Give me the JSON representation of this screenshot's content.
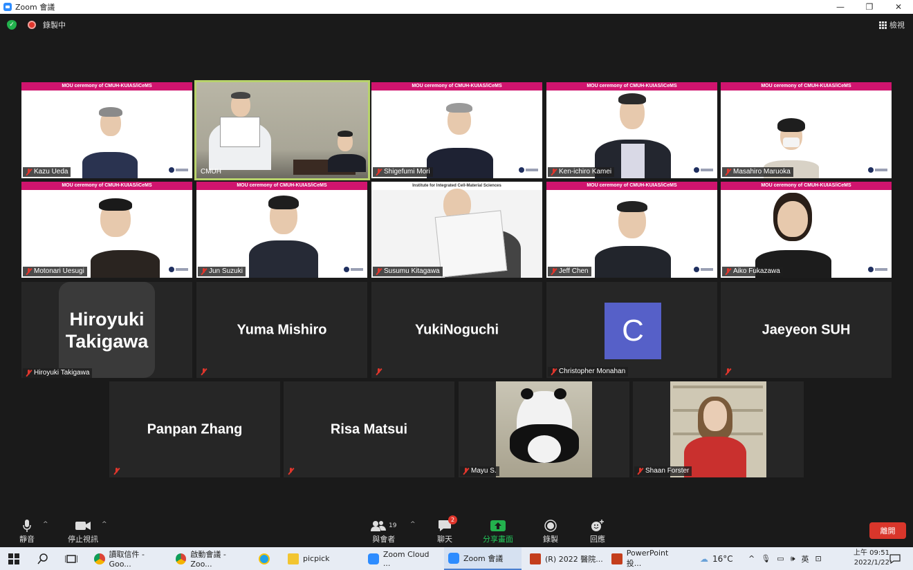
{
  "window": {
    "title": "Zoom 會議",
    "minimize": "—",
    "maximize": "❐",
    "close": "✕"
  },
  "status": {
    "recording": "錄製中",
    "view_label": "檢視"
  },
  "banner_text": "MOU ceremony of CMUH-KUIAS/iCeMS",
  "institute_text": "Institute for Integrated Cell-Material Sciences",
  "participants_row1": [
    {
      "name": "Kazu Ueda"
    },
    {
      "name": "CMUH"
    },
    {
      "name": "Shigefumi Mori"
    },
    {
      "name": "Ken-ichiro Kamei"
    },
    {
      "name": "Masahiro Maruoka"
    }
  ],
  "participants_row2": [
    {
      "name": "Motonari Uesugi"
    },
    {
      "name": "Jun Suzuki"
    },
    {
      "name": "Susumu Kitagawa"
    },
    {
      "name": "Jeff Chen"
    },
    {
      "name": "Aiko Fukazawa"
    }
  ],
  "participants_row3": [
    {
      "name": "Hiroyuki Takigawa",
      "display": "Hiroyuki Takigawa"
    },
    {
      "display": "Yuma Mishiro"
    },
    {
      "display": "YukiNoguchi"
    },
    {
      "name": "Christopher Monahan",
      "avatar_letter": "C"
    },
    {
      "display": "Jaeyeon SUH"
    }
  ],
  "participants_row4": [
    {
      "display": "Panpan Zhang"
    },
    {
      "display": "Risa Matsui"
    },
    {
      "name": "Mayu S."
    },
    {
      "name": "Shaan Forster"
    }
  ],
  "toolbar": {
    "mute": "靜音",
    "stop_video": "停止視訊",
    "participants": "與會者",
    "participants_count": "19",
    "chat": "聊天",
    "chat_badge": "2",
    "share": "分享畫面",
    "record": "錄製",
    "reactions": "回應",
    "leave": "離開"
  },
  "taskbar": {
    "items": [
      {
        "label": "讀取信件 - Goo..."
      },
      {
        "label": "啟動會議 - Zoo..."
      },
      {
        "label": ""
      },
      {
        "label": "picpick"
      },
      {
        "label": "Zoom Cloud ..."
      },
      {
        "label": "Zoom 會議"
      },
      {
        "label": "(R) 2022 醫院..."
      },
      {
        "label": "PowerPoint 投..."
      }
    ],
    "weather": "16°C",
    "ime": "英",
    "time_prefix": "上午",
    "time": "09:51",
    "date": "2022/1/22"
  },
  "colors": {
    "accent_green": "#23b14d",
    "banner": "#d0146e",
    "leave": "#d9362b",
    "avatar_c": "#5660c8",
    "speaker_border": "#b8d36b"
  }
}
